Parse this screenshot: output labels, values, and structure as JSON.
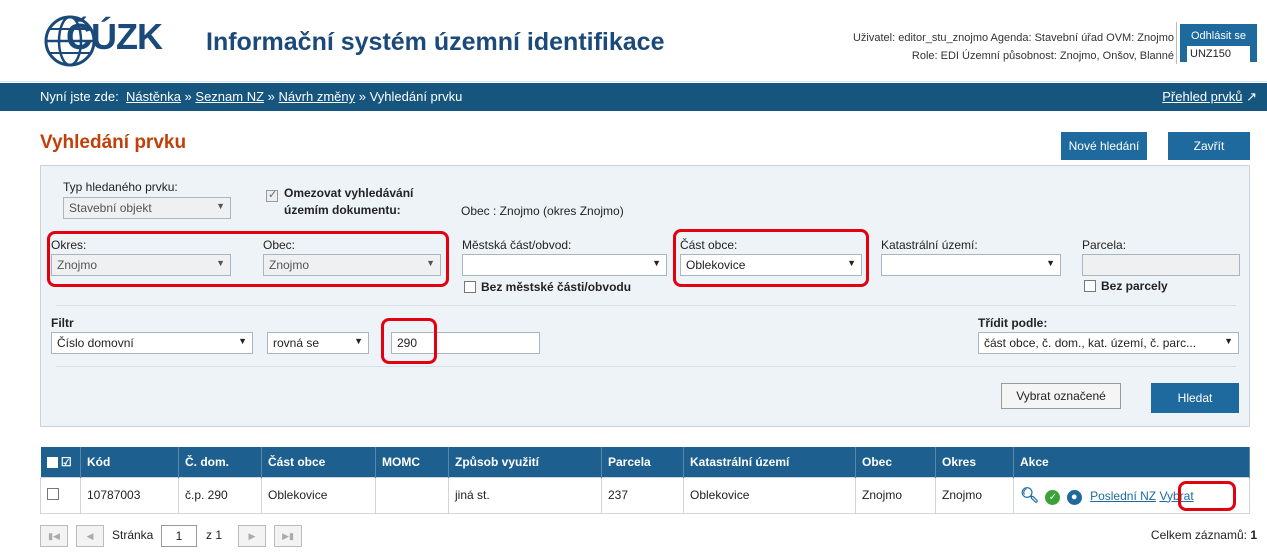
{
  "header": {
    "logo_text": "ČÚZK",
    "app_title": "Informační systém územní identifikace",
    "user_line1": "Uživatel: editor_stu_znojmo   Agenda: Stavební úřad   OVM: Znojmo",
    "user_line2": "Role: EDI   Územní působnost: Znojmo, Onšov, Blanné",
    "logout_label": "Odhlásit se",
    "session_code": "UNZ150"
  },
  "nav": {
    "prefix": "Nyní jste zde:",
    "crumb1": "Nástěnka",
    "crumb2": "Seznam NZ",
    "crumb3": "Návrh změny",
    "crumb4": "Vyhledání prvku",
    "sep": "»",
    "overview": "Přehled prvků"
  },
  "page": {
    "title": "Vyhledání prvku",
    "new_search": "Nové hledání",
    "close": "Zavřít"
  },
  "form": {
    "type_label": "Typ hledaného prvku:",
    "type_value": "Stavební objekt",
    "limit_label_1": "Omezovat vyhledávání",
    "limit_label_2": "územím dokumentu:",
    "limit_value": "Obec : Znojmo (okres Znojmo)",
    "okres_label": "Okres:",
    "okres_value": "Znojmo",
    "obec_label": "Obec:",
    "obec_value": "Znojmo",
    "momc_label": "Městská část/obvod:",
    "momc_value": "",
    "bez_momc": "Bez městské části/obvodu",
    "cast_label": "Část obce:",
    "cast_value": "Oblekovice",
    "ku_label": "Katastrální území:",
    "ku_value": "",
    "parcela_label": "Parcela:",
    "bez_parcely": "Bez parcely",
    "filtr_label": "Filtr",
    "filtr_field": "Číslo domovní",
    "filtr_op": "rovná se",
    "filtr_value": "290",
    "sort_label": "Třídit podle:",
    "sort_value": "část obce, č. dom., kat. území, č. parc...",
    "select_marked": "Vybrat označené",
    "search": "Hledat"
  },
  "table": {
    "columns": [
      "Kód",
      "Č. dom.",
      "Část obce",
      "MOMC",
      "Způsob využití",
      "Parcela",
      "Katastrální území",
      "Obec",
      "Okres",
      "Akce"
    ],
    "rows": [
      {
        "kod": "10787003",
        "cdom": "č.p. 290",
        "cast": "Oblekovice",
        "momc": "",
        "vyuziti": "jiná st.",
        "parcela": "237",
        "ku": "Oblekovice",
        "obec": "Znojmo",
        "okres": "Znojmo",
        "last_nz": "Poslední NZ",
        "select": "Vybrat"
      }
    ]
  },
  "pager": {
    "page_label": "Stránka",
    "page_value": "1",
    "of": "z 1",
    "total_label": "Celkem záznamů:",
    "total_value": "1"
  }
}
